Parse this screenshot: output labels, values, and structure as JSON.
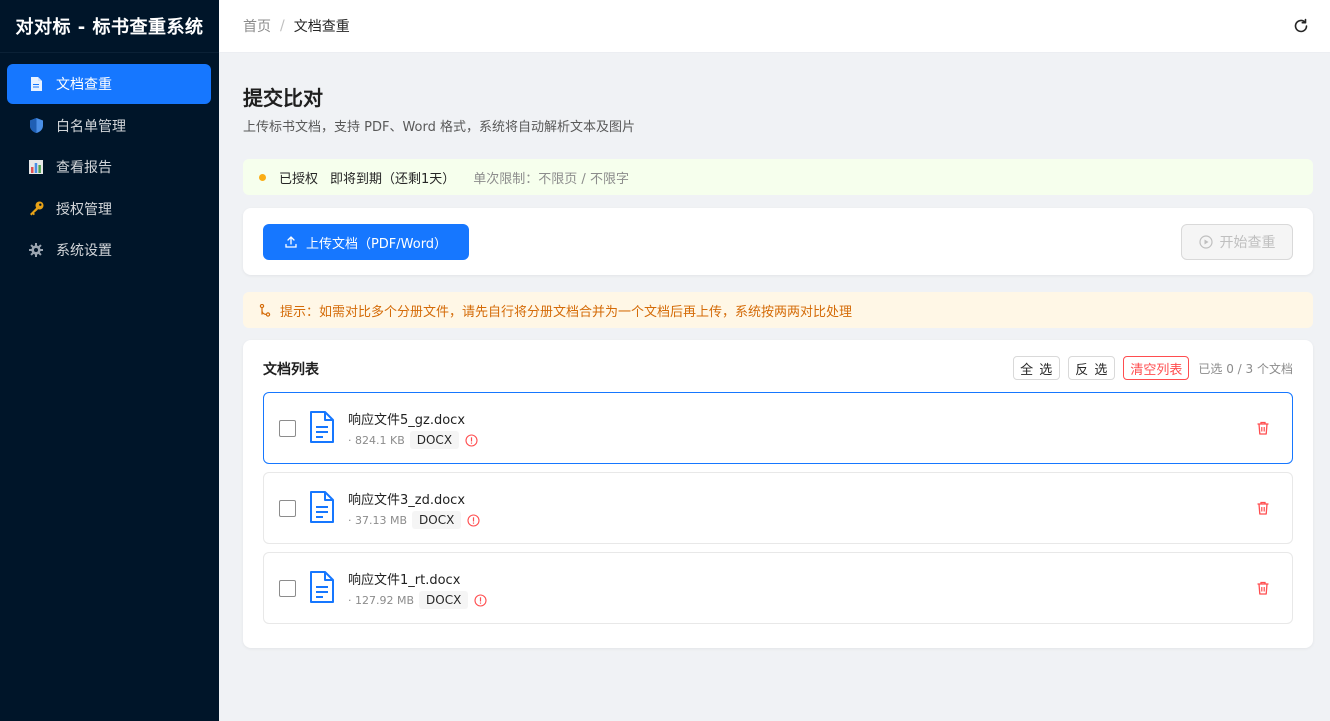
{
  "app": {
    "title": "对对标 - 标书查重系统"
  },
  "sidebar": {
    "items": [
      {
        "label": "文档查重",
        "icon": "document-icon",
        "active": true
      },
      {
        "label": "白名单管理",
        "icon": "shield-icon",
        "active": false
      },
      {
        "label": "查看报告",
        "icon": "bar-chart-icon",
        "active": false
      },
      {
        "label": "授权管理",
        "icon": "key-icon",
        "active": false
      },
      {
        "label": "系统设置",
        "icon": "gear-icon",
        "active": false
      }
    ]
  },
  "header": {
    "breadcrumb": {
      "home": "首页",
      "separator": "/",
      "current": "文档查重"
    },
    "refresh_icon": "refresh-icon"
  },
  "page": {
    "title": "提交比对",
    "subtitle": "上传标书文档，支持 PDF、Word 格式，系统将自动解析文本及图片"
  },
  "license": {
    "status": "已授权",
    "expire": "即将到期（还剩1天）",
    "limit": "单次限制：不限页 / 不限字",
    "status_color": "#faad14"
  },
  "upload": {
    "upload_label": "上传文档（PDF/Word）",
    "start_label": "开始查重"
  },
  "tip": {
    "text": "提示：如需对比多个分册文件，请先自行将分册文档合并为一个文档后再上传，系统按两两对比处理"
  },
  "doc_list": {
    "title": "文档列表",
    "select_all": "全 选",
    "invert": "反 选",
    "clear": "清空列表",
    "selected_count": "已选 0 / 3 个文档",
    "files": [
      {
        "name": "响应文件5_gz.docx",
        "size": "· 824.1 KB",
        "type": "DOCX",
        "selected": false,
        "highlighted": true
      },
      {
        "name": "响应文件3_zd.docx",
        "size": "· 37.13 MB",
        "type": "DOCX",
        "selected": false,
        "highlighted": false
      },
      {
        "name": "响应文件1_rt.docx",
        "size": "· 127.92 MB",
        "type": "DOCX",
        "selected": false,
        "highlighted": false
      }
    ]
  },
  "colors": {
    "primary": "#1677ff",
    "sidebar_bg": "#001529",
    "danger": "#ff4d4f",
    "warning": "#d46b08"
  }
}
